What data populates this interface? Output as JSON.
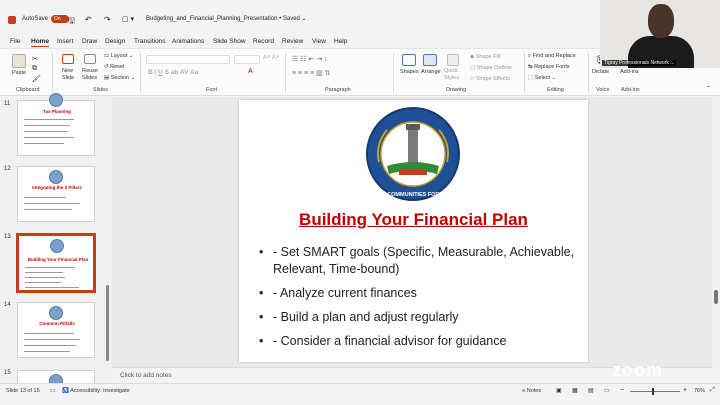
{
  "titlebar": {
    "autosave_label": "AutoSave",
    "autosave_state": "On",
    "file_title": "Budgeting_and_Financial_Planning_Presentation",
    "saved_status": "• Saved",
    "save_icon": "save-icon",
    "undo_icon": "undo-icon",
    "redo_icon": "redo-icon"
  },
  "menu": {
    "items": [
      "File",
      "Home",
      "Insert",
      "Draw",
      "Design",
      "Transitions",
      "Animations",
      "Slide Show",
      "Record",
      "Review",
      "View",
      "Help"
    ],
    "active": "Home"
  },
  "ribbon": {
    "paste": "Paste",
    "new_slide": "New Slide",
    "reuse_slides": "Reuse Slides",
    "layout": "Layout",
    "reset": "Reset",
    "section": "Section",
    "shapes": "Shapes",
    "arrange": "Arrange",
    "quick_styles": "Quick Styles",
    "shape_fill": "Shape Fill",
    "shape_outline": "Shape Outline",
    "shape_effects": "Shape Effects",
    "find_replace": "Find and Replace",
    "replace_fonts": "Replace Fonts",
    "select": "Select",
    "dictate": "Dictate",
    "add_ins": "Add-ins",
    "groups": {
      "clipboard": "Clipboard",
      "slides": "Slides",
      "font": "Font",
      "paragraph": "Paragraph",
      "drawing": "Drawing",
      "editing": "Editing",
      "voice": "Voice",
      "add_ins": "Add-ins"
    }
  },
  "thumbnails": [
    {
      "num": "11",
      "title": "Tax Planning"
    },
    {
      "num": "12",
      "title": "Integrating the 3 Pillars"
    },
    {
      "num": "13",
      "title": "Building Your Financial Plan"
    },
    {
      "num": "14",
      "title": "Common Pitfalls"
    },
    {
      "num": "15",
      "title": ""
    }
  ],
  "slide": {
    "logo_text": "TIGRAY COMMUNITIES FORUM N.A.",
    "title": "Building Your Financial Plan",
    "bullets": [
      "- Set SMART goals (Specific, Measurable, Achievable, Relevant, Time-bound)",
      "- Analyze current finances",
      "- Build a plan and adjust regularly",
      "- Consider a financial advisor for guidance"
    ]
  },
  "notes_placeholder": "Click to add notes",
  "status": {
    "slide_info": "Slide 13 of 15",
    "accessibility": "Accessibility: Investigate",
    "notes_btn": "Notes",
    "zoom": "76%"
  },
  "webcam": {
    "label": "Tigray Professionals Network ..."
  },
  "watermark": "zoom",
  "colors": {
    "accent": "#c43e1c",
    "title_red": "#c00000"
  }
}
